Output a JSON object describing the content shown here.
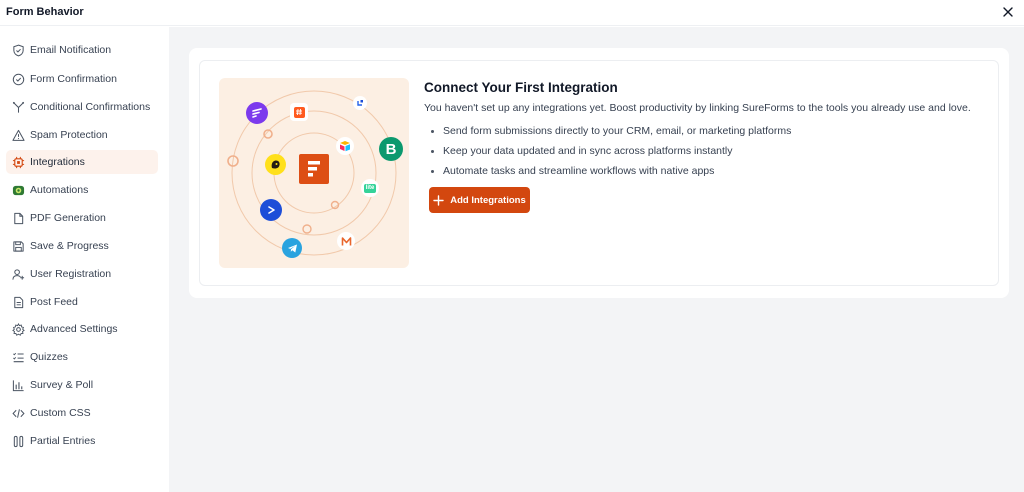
{
  "window": {
    "title": "Form Behavior"
  },
  "sidebar": {
    "items": [
      {
        "label": "Email Notification",
        "icon": "shield-check-icon",
        "active": false
      },
      {
        "label": "Form Confirmation",
        "icon": "check-circle-icon",
        "active": false
      },
      {
        "label": "Conditional Confirmations",
        "icon": "split-arrow-icon",
        "active": false
      },
      {
        "label": "Spam Protection",
        "icon": "warning-triangle-icon",
        "active": false
      },
      {
        "label": "Integrations",
        "icon": "integrations-chip-icon",
        "active": true
      },
      {
        "label": "Automations",
        "icon": "automations-icon",
        "active": false
      },
      {
        "label": "PDF Generation",
        "icon": "file-icon",
        "active": false
      },
      {
        "label": "Save & Progress",
        "icon": "save-disk-icon",
        "active": false
      },
      {
        "label": "User Registration",
        "icon": "user-plus-icon",
        "active": false
      },
      {
        "label": "Post Feed",
        "icon": "document-lines-icon",
        "active": false
      },
      {
        "label": "Advanced Settings",
        "icon": "gear-icon",
        "active": false
      },
      {
        "label": "Quizzes",
        "icon": "list-check-icon",
        "active": false
      },
      {
        "label": "Survey & Poll",
        "icon": "bar-chart-icon",
        "active": false
      },
      {
        "label": "Custom CSS",
        "icon": "code-icon",
        "active": false
      },
      {
        "label": "Partial Entries",
        "icon": "columns-icon",
        "active": false
      }
    ]
  },
  "integration": {
    "heading": "Connect Your First Integration",
    "description": "You haven't set up any integrations yet. Boost productivity by linking SureForms to the tools you already use and love.",
    "bullets": [
      "Send form submissions directly to your CRM, email, or marketing platforms",
      "Keep your data updated and in sync across platforms instantly",
      "Automate tasks and streamline workflows with native apps"
    ],
    "button_label": "Add Integrations",
    "illustration_icons": [
      "sureforms-logo-icon",
      "mailchimp-icon",
      "brevo-icon",
      "telegram-icon",
      "activecampaign-icon",
      "zapier-icon",
      "airtable-icon",
      "fluentcrm-icon",
      "mautic-icon",
      "lite-icon"
    ]
  },
  "colors": {
    "accent": "#d3470f",
    "active_bg": "#fdf2ec",
    "illustration_bg": "#fcefe3",
    "main_bg": "#f3f4f6"
  }
}
